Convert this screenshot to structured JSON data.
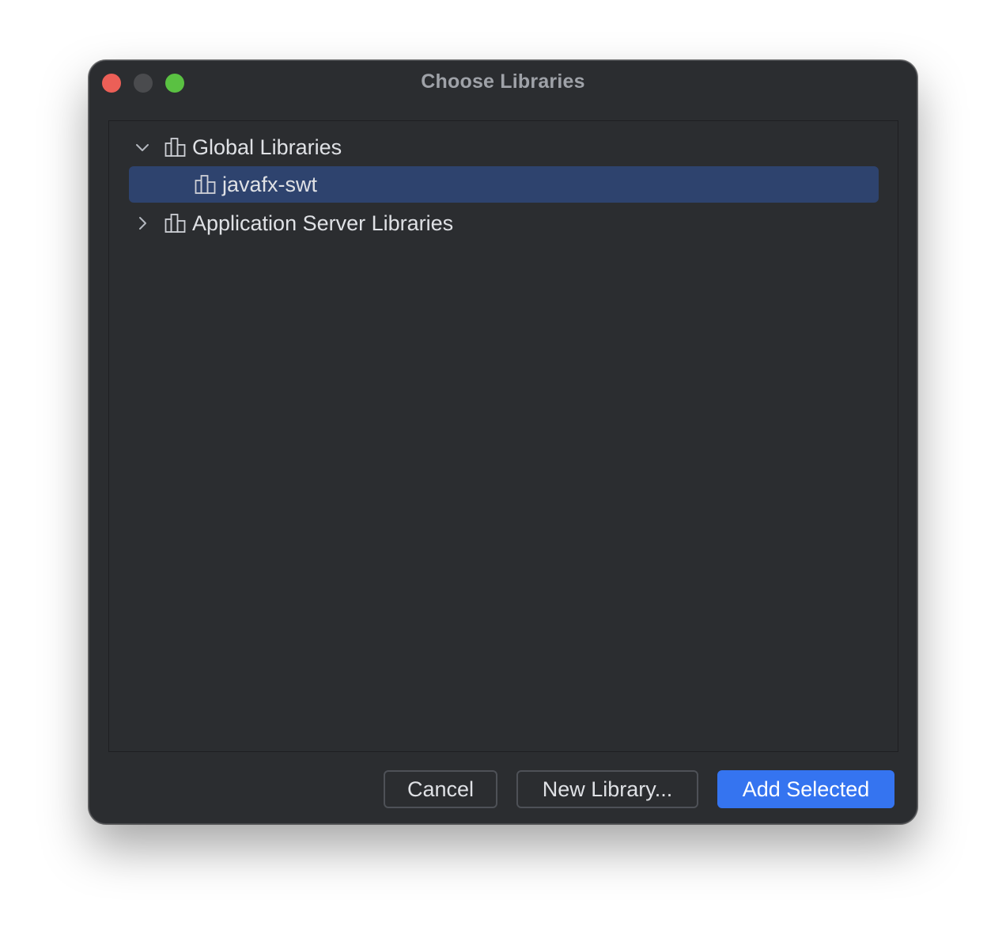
{
  "window": {
    "title": "Choose Libraries"
  },
  "tree": {
    "items": [
      {
        "label": "Global Libraries",
        "expanded": true,
        "icon": "library-icon",
        "level": 0
      },
      {
        "label": "javafx-swt",
        "selected": true,
        "icon": "library-icon",
        "level": 1
      },
      {
        "label": "Application Server Libraries",
        "expanded": false,
        "icon": "library-icon",
        "level": 0
      }
    ]
  },
  "buttons": {
    "cancel": "Cancel",
    "new_library": "New Library...",
    "add_selected": "Add Selected"
  },
  "colors": {
    "window_bg": "#2b2d30",
    "selection_bg": "#2e436e",
    "primary_button": "#3574f0",
    "close": "#ec5f57",
    "minimize": "#4a4b4e",
    "maximize": "#5ac142"
  }
}
